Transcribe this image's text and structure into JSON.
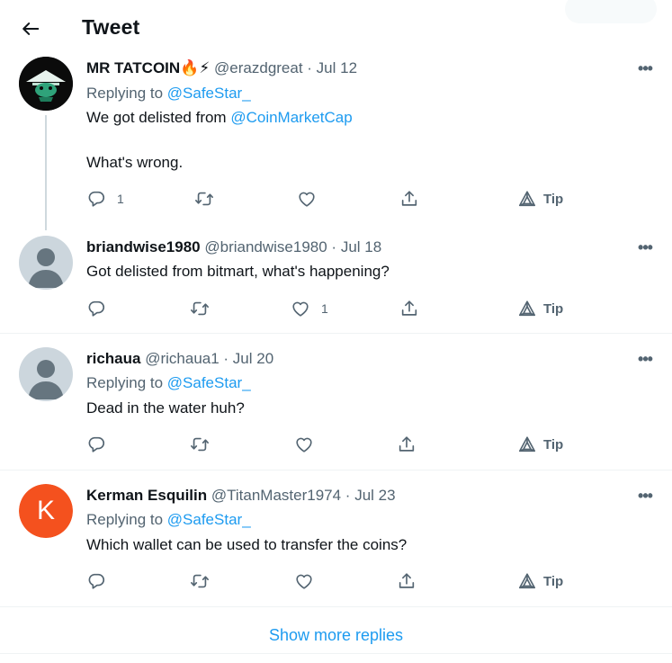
{
  "header": {
    "title": "Tweet"
  },
  "tweets": [
    {
      "name": "MR TATCOIN",
      "emoji": "🔥⚡",
      "handle": "@erazdgreat",
      "date": "Jul 12",
      "replying_prefix": "Replying to ",
      "replying_to": "@SafeStar_",
      "text_prefix": "We got delisted from ",
      "mention": "@CoinMarketCap",
      "text2": "What's wrong.",
      "reply_count": "1",
      "like_count": "",
      "tip": "Tip"
    },
    {
      "name": "briandwise1980",
      "handle": "@briandwise1980",
      "date": "Jul 18",
      "text": "Got delisted from bitmart, what's happening?",
      "reply_count": "",
      "like_count": "1",
      "tip": "Tip"
    },
    {
      "name": "richaua",
      "handle": "@richaua1",
      "date": "Jul 20",
      "replying_prefix": "Replying to ",
      "replying_to": "@SafeStar_",
      "text": "Dead in the water huh?",
      "tip": "Tip"
    },
    {
      "name": "Kerman Esquilin",
      "handle": "@TitanMaster1974",
      "date": "Jul 23",
      "avatar_letter": "K",
      "avatar_color": "#f4511e",
      "replying_prefix": "Replying to ",
      "replying_to": "@SafeStar_",
      "text": "Which wallet can be used to transfer the coins?",
      "tip": "Tip"
    }
  ],
  "show_more": "Show more replies",
  "separator": " · ",
  "more_glyph": "•••",
  "icons": [
    "back-arrow-icon",
    "more-icon",
    "reply-icon",
    "retweet-icon",
    "like-icon",
    "share-icon",
    "tip-icon"
  ],
  "colors": {
    "link": "#1d9bf0",
    "secondary": "#536471",
    "text": "#0f1419"
  }
}
